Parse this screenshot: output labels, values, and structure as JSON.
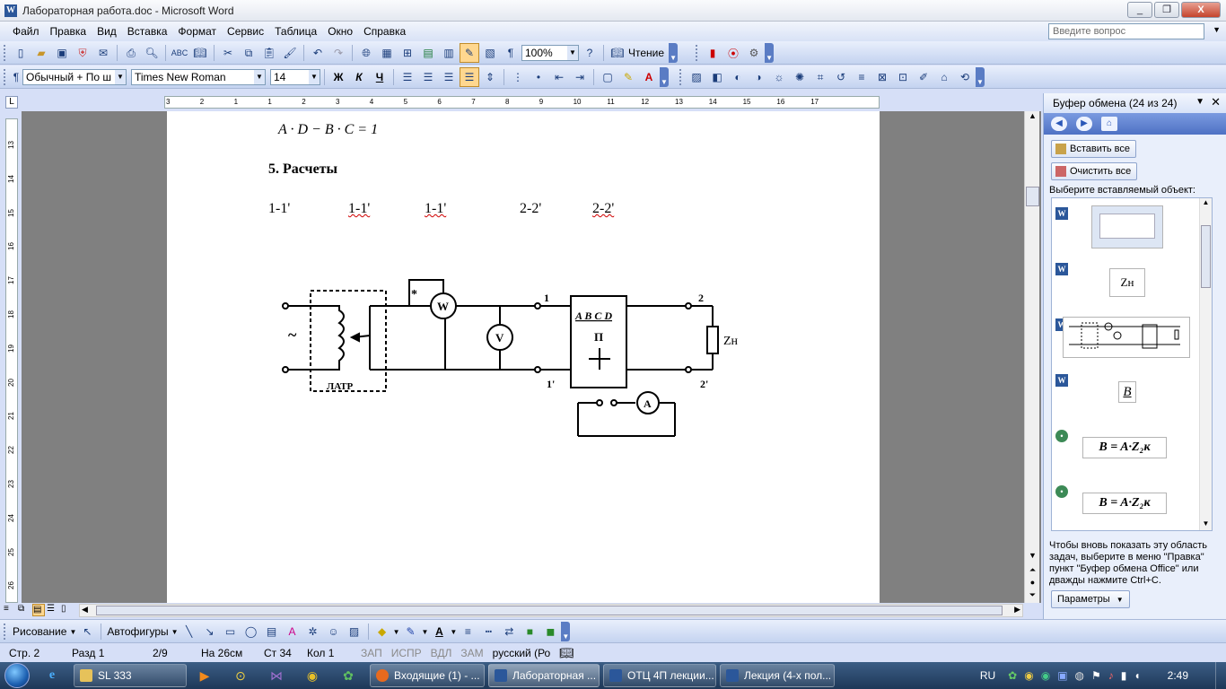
{
  "window": {
    "title": "Лабораторная работа.doc - Microsoft Word",
    "controls": [
      "_",
      "❐",
      "X"
    ]
  },
  "menu": {
    "items": [
      "Файл",
      "Правка",
      "Вид",
      "Вставка",
      "Формат",
      "Сервис",
      "Таблица",
      "Окно",
      "Справка"
    ],
    "ask_placeholder": "Введите вопрос"
  },
  "standard_toolbar": {
    "zoom": "100%",
    "reading_label": "Чтение"
  },
  "format_toolbar": {
    "style": "Обычный + По ш",
    "font": "Times New Roman",
    "size": "14",
    "bold": "Ж",
    "italic": "К",
    "underline": "Ч"
  },
  "document": {
    "formula": "A · D − B · C = 1",
    "heading": "5. Расчеты",
    "labels": [
      "1-1'",
      "1-1'",
      "1-1'",
      "2-2'",
      "2-2'"
    ],
    "diagram": {
      "tilde": "~",
      "latr": "ЛАТР",
      "wattmeter": "W",
      "voltmeter": "V",
      "ammeter": "A",
      "star": "*",
      "block_title": "A B C D",
      "block_letter": "П",
      "node_1": "1",
      "node_1p": "1'",
      "node_2": "2",
      "node_2p": "2'",
      "load": "Zн"
    }
  },
  "ruler": {
    "h_ticks": [
      "3",
      "2",
      "1",
      "1",
      "2",
      "3",
      "4",
      "5",
      "6",
      "7",
      "8",
      "9",
      "10",
      "11",
      "12",
      "13",
      "14",
      "15",
      "16",
      "17"
    ],
    "v_ticks": [
      "13",
      "14",
      "15",
      "16",
      "17",
      "18",
      "19",
      "20",
      "21",
      "22",
      "23",
      "24",
      "25",
      "26"
    ]
  },
  "task_pane": {
    "title": "Буфер обмена (24 из 24)",
    "paste_all": "Вставить все",
    "clear_all": "Очистить все",
    "select_label": "Выберите вставляемый объект:",
    "items": [
      "",
      "Zн",
      "",
      "B",
      "B = A·Z₂к",
      "B = A·Z₂к"
    ],
    "footer": "Чтобы вновь показать эту область задач, выберите в меню \"Правка\" пункт \"Буфер обмена Office\" или дважды нажмите Ctrl+C.",
    "options": "Параметры"
  },
  "drawing_toolbar": {
    "draw": "Рисование",
    "autoshapes": "Автофигуры"
  },
  "status": {
    "page": "Стр. 2",
    "section": "Разд 1",
    "pages": "2/9",
    "at": "На 26см",
    "line": "Ст 34",
    "col": "Кол 1",
    "rec": "ЗАП",
    "trk": "ИСПР",
    "ext": "ВДЛ",
    "ovr": "ЗАМ",
    "lang": "русский (Ро"
  },
  "taskbar": {
    "items": [
      "SL 333",
      "Входящие (1) - ...",
      "Лабораторная ...",
      "ОТЦ 4П лекции...",
      "Лекция (4-х пол..."
    ],
    "lang": "RU",
    "time": "2:49"
  },
  "colors": {
    "accent": "#2b579a",
    "taskbar": "#1e3858",
    "pane": "#e9effb",
    "spell": "#d00000"
  }
}
